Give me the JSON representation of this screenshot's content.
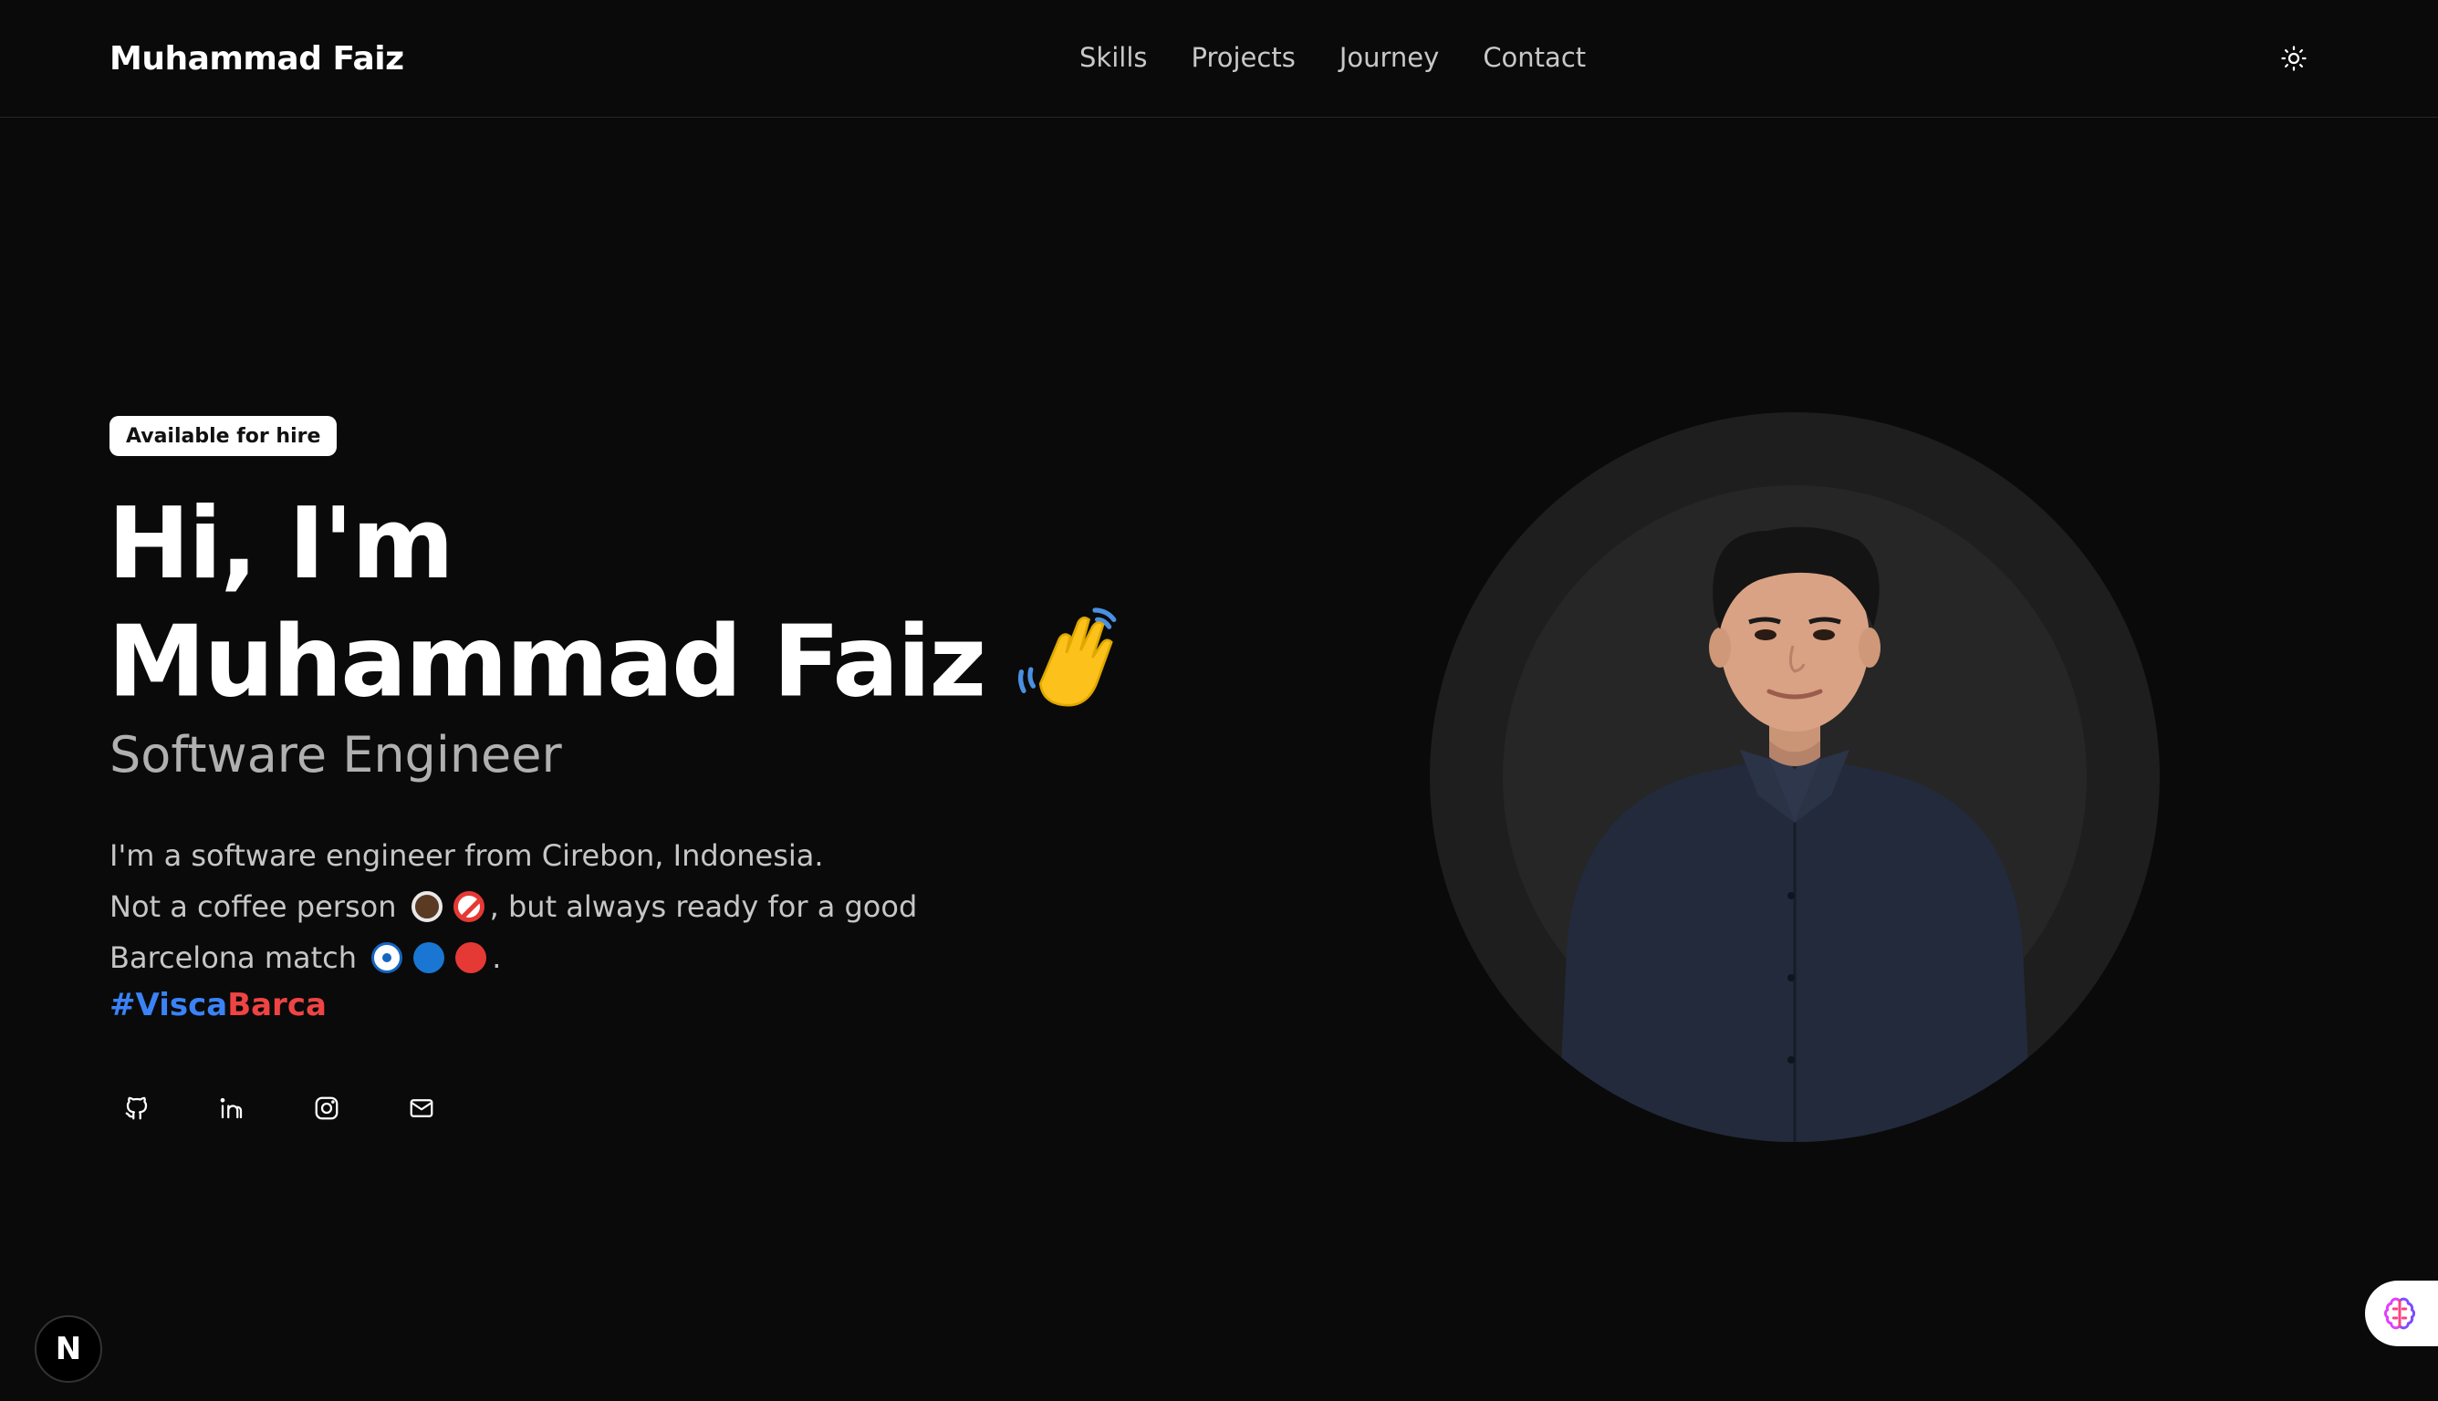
{
  "header": {
    "brand": "Muhammad Faiz",
    "nav": [
      "Skills",
      "Projects",
      "Journey",
      "Contact"
    ],
    "theme_icon": "sun-icon"
  },
  "hero": {
    "badge": "Available for hire",
    "greeting": "Hi, I'm",
    "name": "Muhammad Faiz",
    "wave_icon": "waving-hand-icon",
    "title": "Software Engineer",
    "bio_line1": "I'm a software engineer from Cirebon, Indonesia.",
    "bio_line2_a": "Not a coffee person",
    "bio_line2_b": ", but always ready for a good",
    "bio_line3_a": "Barcelona match",
    "bio_line3_b": ".",
    "hashtag_part1": "#Visca",
    "hashtag_part2": "Barca",
    "emoji_icons": [
      "coffee-icon",
      "prohibited-icon",
      "soccer-ball-icon",
      "blue-circle-icon",
      "red-circle-icon"
    ],
    "hashtag_colors": {
      "visca": "#3b82f6",
      "barca": "#ef4444"
    }
  },
  "socials": [
    {
      "icon": "github-icon"
    },
    {
      "icon": "linkedin-icon"
    },
    {
      "icon": "instagram-icon"
    },
    {
      "icon": "mail-icon"
    }
  ],
  "floating": {
    "next_badge": "N",
    "assistant_icon": "brain-icon"
  },
  "colors": {
    "background": "#0a0a0a",
    "text": "#ffffff",
    "muted": "#b0b0b0"
  }
}
